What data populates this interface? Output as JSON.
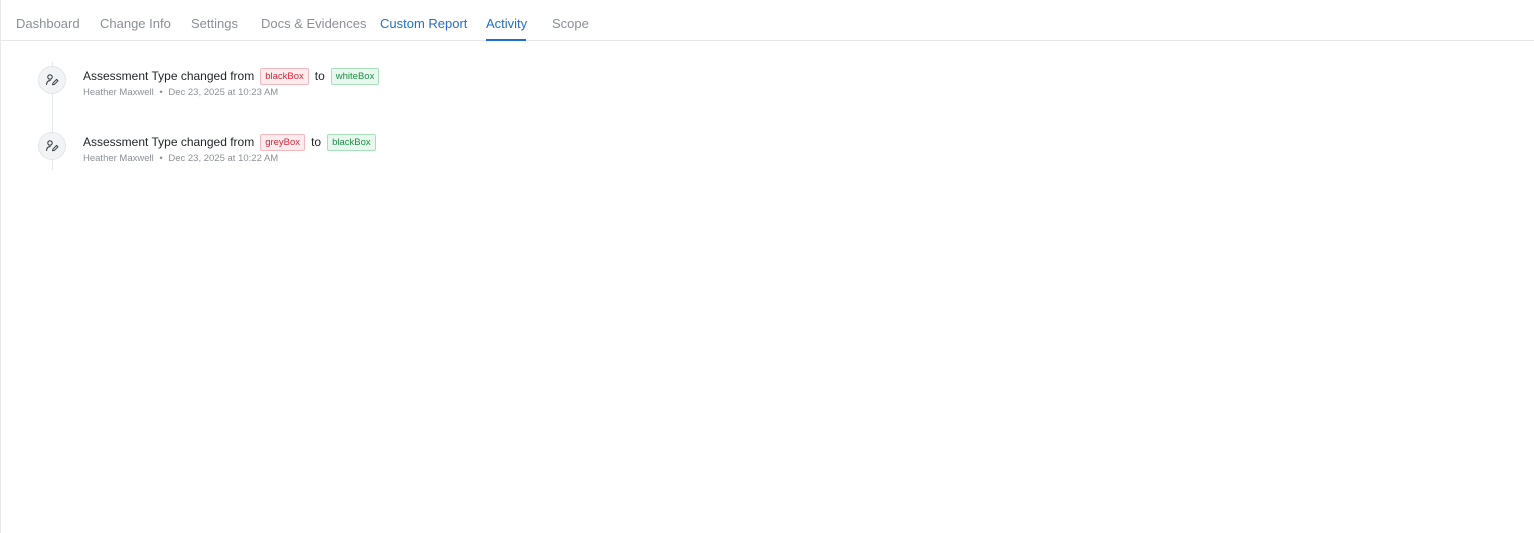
{
  "tabs": [
    {
      "label": "Dashboard"
    },
    {
      "label": "Change Info"
    },
    {
      "label": "Settings"
    },
    {
      "label": "Docs & Evidences"
    },
    {
      "label": "Custom Report"
    },
    {
      "label": "Activity"
    },
    {
      "label": "Scope"
    }
  ],
  "active_tab": "Activity",
  "colors": {
    "accent": "#1f6fd1",
    "old_value": "#cf2a3a",
    "new_value": "#1a8f45"
  },
  "activities": [
    {
      "icon": "user-edit-icon",
      "text": "Assessment Type changed from",
      "old_value": "blackBox",
      "connector": "to",
      "new_value": "whiteBox",
      "user": "Heather Maxwell",
      "separator": "•",
      "timestamp": "Dec 23, 2025 at 10:23 AM"
    },
    {
      "icon": "user-edit-icon",
      "text": "Assessment Type changed from",
      "old_value": "greyBox",
      "connector": "to",
      "new_value": "blackBox",
      "user": "Heather Maxwell",
      "separator": "•",
      "timestamp": "Dec 23, 2025 at 10:22 AM"
    }
  ]
}
